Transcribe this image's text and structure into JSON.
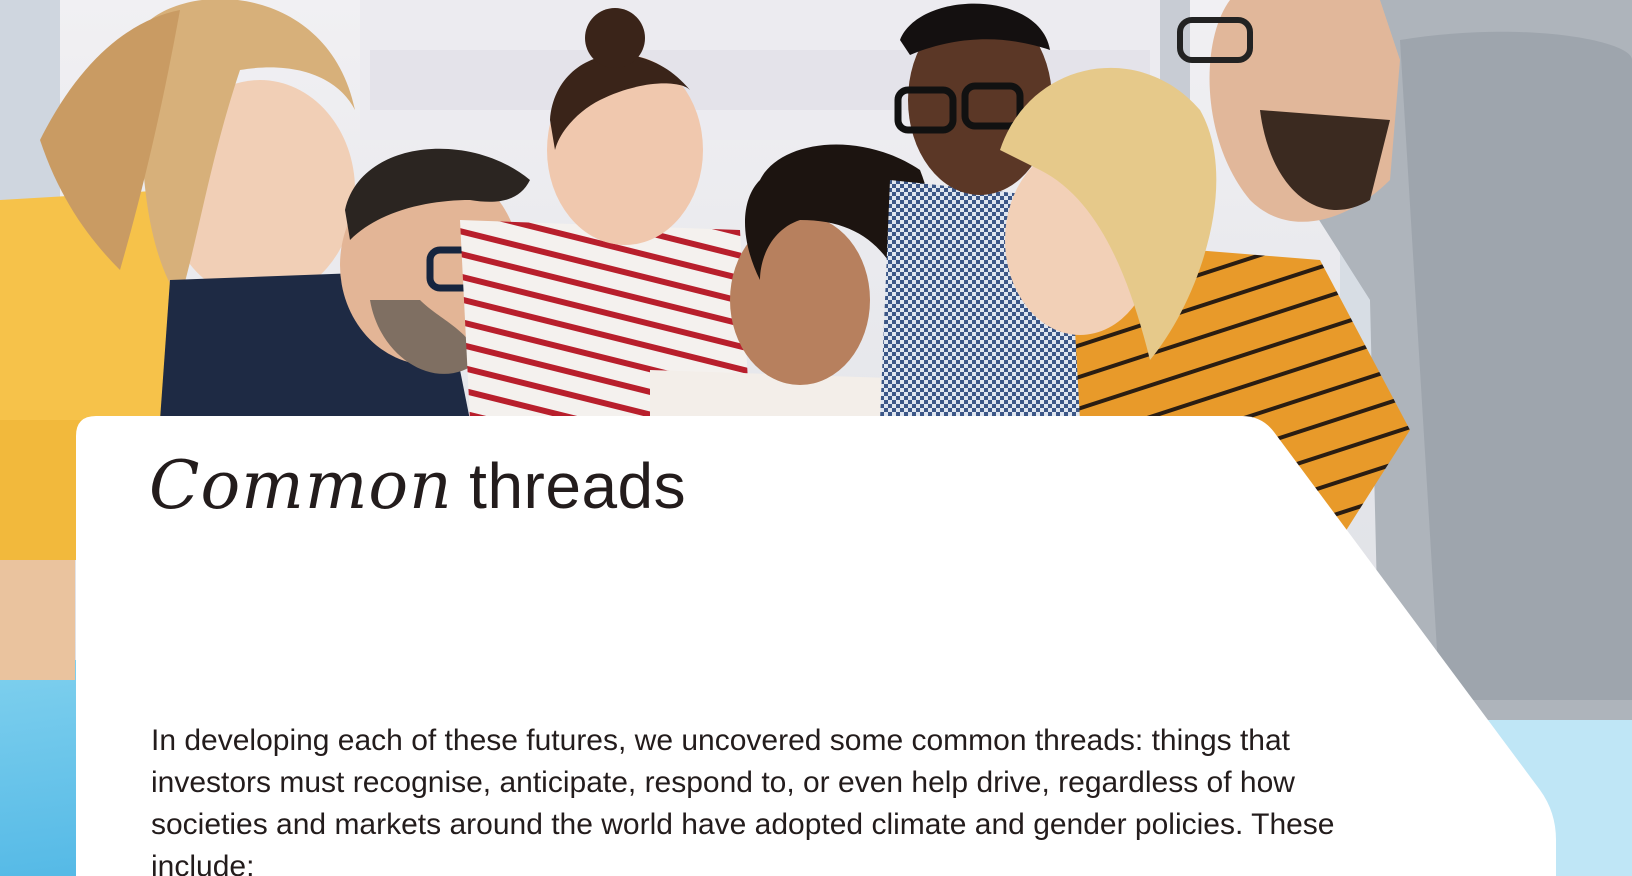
{
  "hero": {
    "image_description_icon": "group-photo-icon"
  },
  "heading": {
    "italic_word": "Common",
    "regular_word": "threads"
  },
  "body": {
    "paragraph": "In developing each of these futures, we uncovered some common threads: things that investors must recognise, anticipate, respond to, or even help drive, regardless of how societies and markets around the world have adopted climate and gender policies. These include:"
  },
  "colors": {
    "text": "#231c1c",
    "card": "#ffffff",
    "accent_yellow": "#f6c24a",
    "accent_orange": "#e8a132",
    "navy": "#1e2a44"
  }
}
